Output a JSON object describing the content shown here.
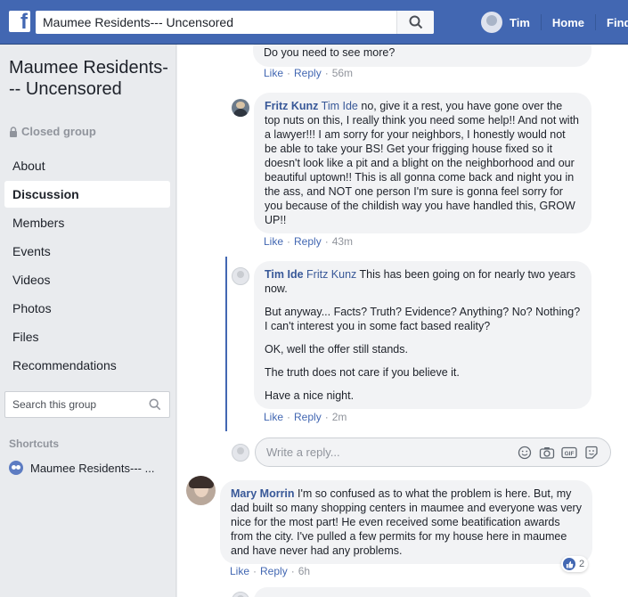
{
  "topbar": {
    "search_value": "Maumee Residents--- Uncensored",
    "user_name": "Tim",
    "home_label": "Home",
    "find_label": "Find"
  },
  "sidebar": {
    "group_title": "Maumee Residents--- Uncensored",
    "privacy": "Closed group",
    "nav": [
      "About",
      "Discussion",
      "Members",
      "Events",
      "Videos",
      "Photos",
      "Files",
      "Recommendations"
    ],
    "active_nav": "Discussion",
    "search_placeholder": "Search this group",
    "shortcuts_heading": "Shortcuts",
    "shortcut_item": "Maumee Residents--- ..."
  },
  "feed": {
    "top_comment": {
      "text": "Do you need to see more?",
      "like": "Like",
      "reply": "Reply",
      "time": "56m"
    },
    "fritz_comment": {
      "author": "Fritz Kunz",
      "mention": "Tim Ide",
      "text": "no, give it a rest, you have gone over the top nuts on this, I really think you need some help!! And not with a lawyer!!! I am sorry for your neighbors, I honestly would not be able to take your BS! Get your frigging house fixed so it doesn't look like a pit and a blight on the neighborhood and our beautiful uptown!! This is all gonna come back and night you in the ass, and NOT one person I'm sure is gonna feel sorry for you because of the childish way you have handled this, GROW UP!!",
      "like": "Like",
      "reply": "Reply",
      "time": "43m"
    },
    "tim_comment": {
      "author": "Tim Ide",
      "mention": "Fritz Kunz",
      "para1": "This has been going on for nearly two years now.",
      "para2": "But anyway... Facts? Truth? Evidence? Anything? No? Nothing? I can't interest you in some fact based reality?",
      "para3": "OK, well the offer still stands.",
      "para4": "The truth does not care if you believe it.",
      "para5": "Have a nice night.",
      "like": "Like",
      "reply": "Reply",
      "time": "2m"
    },
    "reply_placeholder": "Write a reply...",
    "mary_comment": {
      "author": "Mary Morrin",
      "text": "I'm so confused as to what the problem is here. But, my dad built so many shopping centers in maumee and everyone was very nice for the most part! He even received some beatification awards from the city. I've pulled a few permits for my house here in maumee and have never had any problems.",
      "like": "Like",
      "reply": "Reply",
      "time": "6h",
      "reactions": "2"
    }
  },
  "colors": {
    "brand": "#4267b2",
    "link": "#385898",
    "bubble": "#f2f3f5"
  }
}
